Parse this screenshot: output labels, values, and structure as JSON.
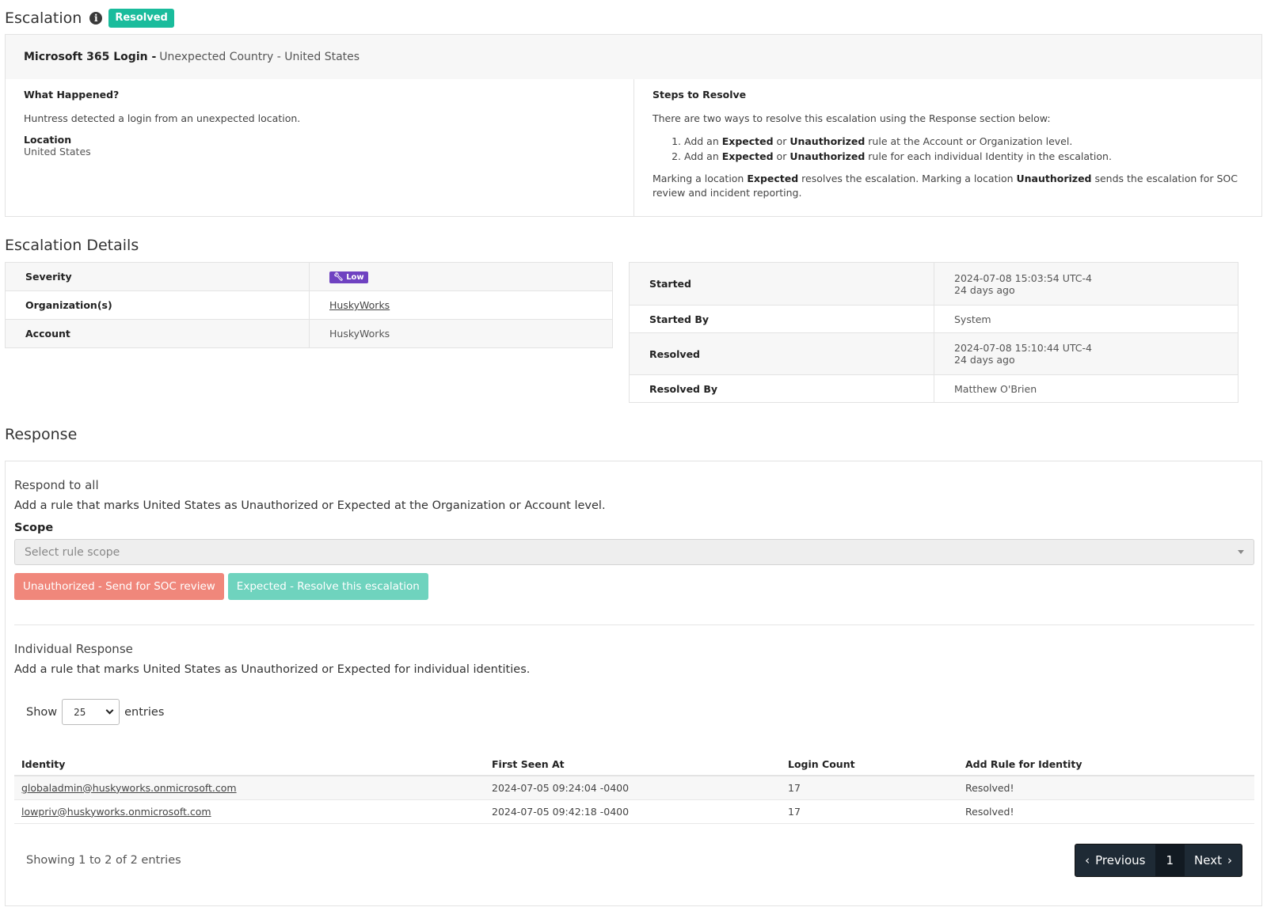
{
  "header": {
    "title": "Escalation",
    "status_badge": "Resolved"
  },
  "summary": {
    "product": "Microsoft 365 Login -",
    "subtitle": "Unexpected Country - United States",
    "what_happened": {
      "heading": "What Happened?",
      "text": "Huntress detected a login from an unexpected location.",
      "location_label": "Location",
      "location_value": "United States"
    },
    "steps": {
      "heading": "Steps to Resolve",
      "intro": "There are two ways to resolve this escalation using the Response section below:",
      "items": [
        {
          "pre": "Add an ",
          "b1": "Expected",
          "mid": " or ",
          "b2": "Unauthorized",
          "post": " rule at the Account or Organization level."
        },
        {
          "pre": "Add an ",
          "b1": "Expected",
          "mid": " or ",
          "b2": "Unauthorized",
          "post": " rule for each individual Identity in the escalation."
        }
      ],
      "note_pre": "Marking a location ",
      "note_b1": "Expected",
      "note_mid": " resolves the escalation. Marking a location ",
      "note_b2": "Unauthorized",
      "note_post": " sends the escalation for SOC review and incident reporting."
    }
  },
  "details": {
    "title": "Escalation Details",
    "left": {
      "severity_label": "Severity",
      "severity_value": "Low",
      "org_label": "Organization(s)",
      "org_value": "HuskyWorks",
      "account_label": "Account",
      "account_value": "HuskyWorks"
    },
    "right": {
      "started_label": "Started",
      "started_value": "2024-07-08 15:03:54 UTC-4",
      "started_ago": "24 days ago",
      "started_by_label": "Started By",
      "started_by_value": "System",
      "resolved_label": "Resolved",
      "resolved_value": "2024-07-08 15:10:44 UTC-4",
      "resolved_ago": "24 days ago",
      "resolved_by_label": "Resolved By",
      "resolved_by_value": "Matthew O'Brien"
    }
  },
  "response": {
    "title": "Response",
    "all_heading": "Respond to all",
    "all_text": "Add a rule that marks United States as Unauthorized or Expected at the Organization or Account level.",
    "scope_label": "Scope",
    "scope_placeholder": "Select rule scope",
    "btn_unauthorized": "Unauthorized - Send for SOC review",
    "btn_expected": "Expected - Resolve this escalation",
    "individual_heading": "Individual Response",
    "individual_text": "Add a rule that marks United States as Unauthorized or Expected for individual identities.",
    "show_label": "Show",
    "entries_value": "25",
    "entries_label": "entries",
    "columns": [
      "Identity",
      "First Seen At",
      "Login Count",
      "Add Rule for Identity"
    ],
    "rows": [
      {
        "identity": "globaladmin@huskyworks.onmicrosoft.com",
        "first_seen": "2024-07-05 09:24:04 -0400",
        "count": "17",
        "rule": "Resolved!"
      },
      {
        "identity": "lowpriv@huskyworks.onmicrosoft.com",
        "first_seen": "2024-07-05 09:42:18 -0400",
        "count": "17",
        "rule": "Resolved!"
      }
    ],
    "showing": "Showing 1 to 2 of 2 entries",
    "pager": {
      "prev": "Previous",
      "page": "1",
      "next": "Next"
    }
  }
}
